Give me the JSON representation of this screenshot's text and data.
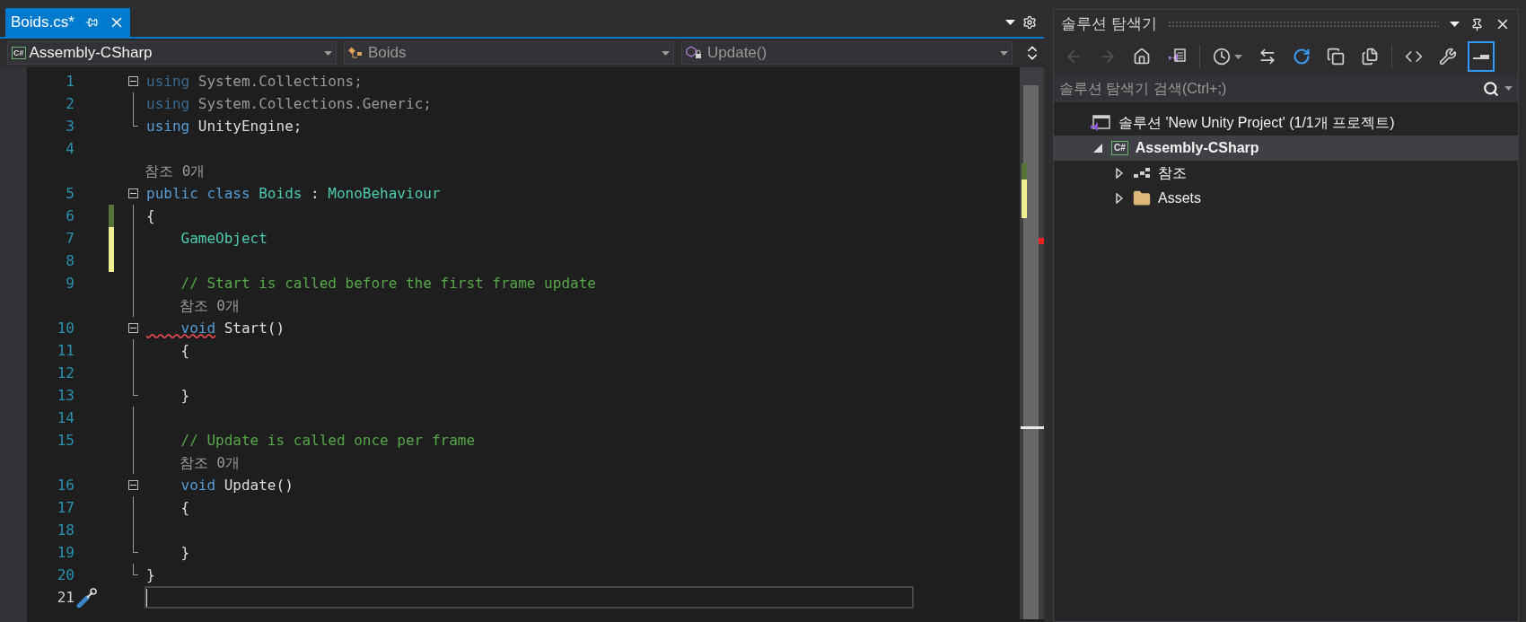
{
  "tabs": [
    {
      "label": "Boids.cs*",
      "selected": true
    }
  ],
  "nav_bar": [
    {
      "kind": "project",
      "badge": "C#",
      "text": "Assembly-CSharp"
    },
    {
      "kind": "class",
      "text": "Boids"
    },
    {
      "kind": "method",
      "text": "Update()"
    }
  ],
  "code_rows": [
    {
      "kind": "code",
      "number": "1",
      "collapsible": true,
      "current": false,
      "tokens": [
        {
          "kind": "keyword_faded",
          "s": "using",
          "error": false
        },
        {
          "kind": "plain_faded",
          "s": " System.Collections;",
          "error": false
        }
      ]
    },
    {
      "kind": "code",
      "number": "2",
      "collapsible": false,
      "region": {
        "kind": "inside"
      },
      "current": false,
      "tokens": [
        {
          "kind": "keyword_faded",
          "s": "using",
          "error": false
        },
        {
          "kind": "plain_faded",
          "s": " System.Collections.Generic;",
          "error": false
        }
      ]
    },
    {
      "kind": "code",
      "number": "3",
      "collapsible": false,
      "region": {
        "kind": "end"
      },
      "current": false,
      "tokens": [
        {
          "kind": "keyword",
          "s": "using",
          "error": false
        },
        {
          "kind": "plain",
          "s": " UnityEngine;",
          "error": false
        }
      ]
    },
    {
      "kind": "code",
      "number": "4",
      "collapsible": false,
      "current": false,
      "tokens": []
    },
    {
      "kind": "lens",
      "text": "참조 0개"
    },
    {
      "kind": "code",
      "number": "5",
      "collapsible": true,
      "current": false,
      "tokens": [
        {
          "kind": "keyword",
          "s": "public class",
          "error": false
        },
        {
          "kind": "type",
          "s": " Boids",
          "error": false
        },
        {
          "kind": "plain",
          "s": " : ",
          "error": false
        },
        {
          "kind": "type",
          "s": "MonoBehaviour",
          "error": false
        }
      ]
    },
    {
      "kind": "code",
      "number": "6",
      "collapsible": false,
      "region": {
        "kind": "inside"
      },
      "change_bar": {
        "kind": "saved"
      },
      "current": false,
      "tokens": [
        {
          "kind": "plain",
          "s": "{",
          "error": false
        }
      ]
    },
    {
      "kind": "code",
      "number": "7",
      "collapsible": false,
      "region": {
        "kind": "inside"
      },
      "change_bar": {
        "kind": "unsaved"
      },
      "current": false,
      "tokens": [
        {
          "kind": "type",
          "s": "    GameObject",
          "error": false
        }
      ]
    },
    {
      "kind": "code",
      "number": "8",
      "collapsible": false,
      "region": {
        "kind": "inside"
      },
      "change_bar": {
        "kind": "unsaved"
      },
      "current": false,
      "tokens": []
    },
    {
      "kind": "code",
      "number": "9",
      "collapsible": false,
      "region": {
        "kind": "inside"
      },
      "current": false,
      "tokens": [
        {
          "kind": "comment",
          "s": "    // Start is called before the first frame update",
          "error": false
        }
      ]
    },
    {
      "kind": "lens",
      "text": "    참조 0개",
      "region": {
        "kind": "inside"
      }
    },
    {
      "kind": "code",
      "number": "10",
      "collapsible": true,
      "current": false,
      "tokens": [
        {
          "kind": "keyword",
          "s": "    void",
          "error": true
        },
        {
          "kind": "plain",
          "s": " Start()",
          "error": false
        }
      ]
    },
    {
      "kind": "code",
      "number": "11",
      "collapsible": false,
      "region": {
        "kind": "inside"
      },
      "current": false,
      "tokens": [
        {
          "kind": "plain",
          "s": "    {",
          "error": false
        }
      ]
    },
    {
      "kind": "code",
      "number": "12",
      "collapsible": false,
      "region": {
        "kind": "inside"
      },
      "current": false,
      "tokens": []
    },
    {
      "kind": "code",
      "number": "13",
      "collapsible": false,
      "region": {
        "kind": "end"
      },
      "current": false,
      "tokens": [
        {
          "kind": "plain",
          "s": "    }",
          "error": false
        }
      ]
    },
    {
      "kind": "code",
      "number": "14",
      "collapsible": false,
      "region": {
        "kind": "inside"
      },
      "current": false,
      "tokens": []
    },
    {
      "kind": "code",
      "number": "15",
      "collapsible": false,
      "region": {
        "kind": "inside"
      },
      "current": false,
      "tokens": [
        {
          "kind": "comment",
          "s": "    // Update is called once per frame",
          "error": false
        }
      ]
    },
    {
      "kind": "lens",
      "text": "    참조 0개",
      "region": {
        "kind": "inside"
      }
    },
    {
      "kind": "code",
      "number": "16",
      "collapsible": true,
      "current": false,
      "tokens": [
        {
          "kind": "keyword",
          "s": "    void",
          "error": false
        },
        {
          "kind": "plain",
          "s": " Update()",
          "error": false
        }
      ]
    },
    {
      "kind": "code",
      "number": "17",
      "collapsible": false,
      "region": {
        "kind": "inside"
      },
      "current": false,
      "tokens": [
        {
          "kind": "plain",
          "s": "    {",
          "error": false
        }
      ]
    },
    {
      "kind": "code",
      "number": "18",
      "collapsible": false,
      "region": {
        "kind": "inside"
      },
      "current": false,
      "tokens": []
    },
    {
      "kind": "code",
      "number": "19",
      "collapsible": false,
      "region": {
        "kind": "end"
      },
      "current": false,
      "tokens": [
        {
          "kind": "plain",
          "s": "    }",
          "error": false
        }
      ]
    },
    {
      "kind": "code",
      "number": "20",
      "collapsible": false,
      "region": {
        "kind": "end"
      },
      "current": false,
      "tokens": [
        {
          "kind": "plain",
          "s": "}",
          "error": false
        }
      ]
    },
    {
      "kind": "code",
      "number": "21",
      "collapsible": false,
      "current": true,
      "tokens": []
    }
  ],
  "solution_explorer": {
    "title": "솔루션 탐색기",
    "toolbar_groups": [
      {
        "buttons": [
          {
            "kind": "back",
            "disabled": true,
            "selected": false
          },
          {
            "kind": "forward",
            "disabled": true,
            "selected": false
          },
          {
            "kind": "home",
            "disabled": false,
            "selected": false
          },
          {
            "kind": "switch_views",
            "disabled": false,
            "selected": false
          }
        ]
      },
      {
        "buttons": [
          {
            "kind": "pending_changes",
            "disabled": false,
            "selected": false
          },
          {
            "kind": "sync",
            "disabled": false,
            "selected": false
          },
          {
            "kind": "refresh",
            "disabled": false,
            "selected": false
          },
          {
            "kind": "collapse",
            "disabled": false,
            "selected": false
          },
          {
            "kind": "show_all",
            "disabled": false,
            "selected": false
          }
        ]
      },
      {
        "buttons": [
          {
            "kind": "view_code",
            "disabled": false,
            "selected": false
          },
          {
            "kind": "properties",
            "disabled": false,
            "selected": false
          },
          {
            "kind": "preview",
            "disabled": false,
            "selected": true
          }
        ]
      }
    ],
    "search": {
      "placeholder": "솔루션 탐색기 검색(Ctrl+;)"
    },
    "tree": [
      {
        "kind": "solution",
        "label": "솔루션 'New Unity Project' (1/1개 프로젝트)",
        "selected": false,
        "children": [
          {
            "kind": "project",
            "badge": "C#",
            "label": "Assembly-CSharp",
            "selected": true,
            "expanded": true,
            "children": [
              {
                "kind": "references",
                "label": "참조",
                "selected": false,
                "expanded": false
              },
              {
                "kind": "folder",
                "label": "Assets",
                "selected": false,
                "expanded": false
              }
            ]
          }
        ]
      }
    ]
  }
}
